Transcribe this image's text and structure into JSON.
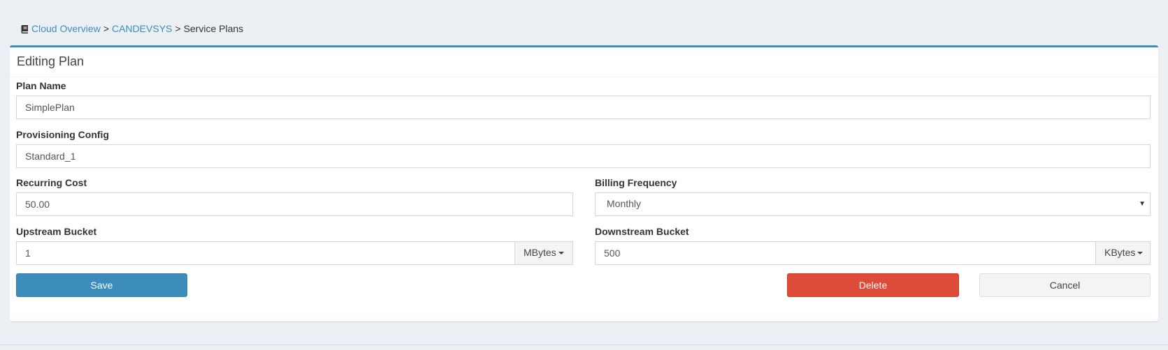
{
  "breadcrumb": {
    "icon": "book-icon",
    "items": [
      "Cloud Overview",
      "CANDEVSYS",
      "Service Plans"
    ],
    "separator": ">"
  },
  "panel": {
    "title": "Editing Plan",
    "accent_color": "#3c8dbc"
  },
  "form": {
    "plan_name": {
      "label": "Plan Name",
      "value": "SimplePlan"
    },
    "provisioning_config": {
      "label": "Provisioning Config",
      "value": "Standard_1"
    },
    "recurring_cost": {
      "label": "Recurring Cost",
      "value": "50.00"
    },
    "billing_frequency": {
      "label": "Billing Frequency",
      "selected": "Monthly"
    },
    "upstream_bucket": {
      "label": "Upstream Bucket",
      "value": "1",
      "unit": "MBytes"
    },
    "downstream_bucket": {
      "label": "Downstream Bucket",
      "value": "500",
      "unit": "KBytes"
    }
  },
  "buttons": {
    "save": {
      "label": "Save",
      "color": "#3c8dbc"
    },
    "delete": {
      "label": "Delete",
      "color": "#dd4b39"
    },
    "cancel": {
      "label": "Cancel",
      "color": "#f4f4f4"
    }
  }
}
